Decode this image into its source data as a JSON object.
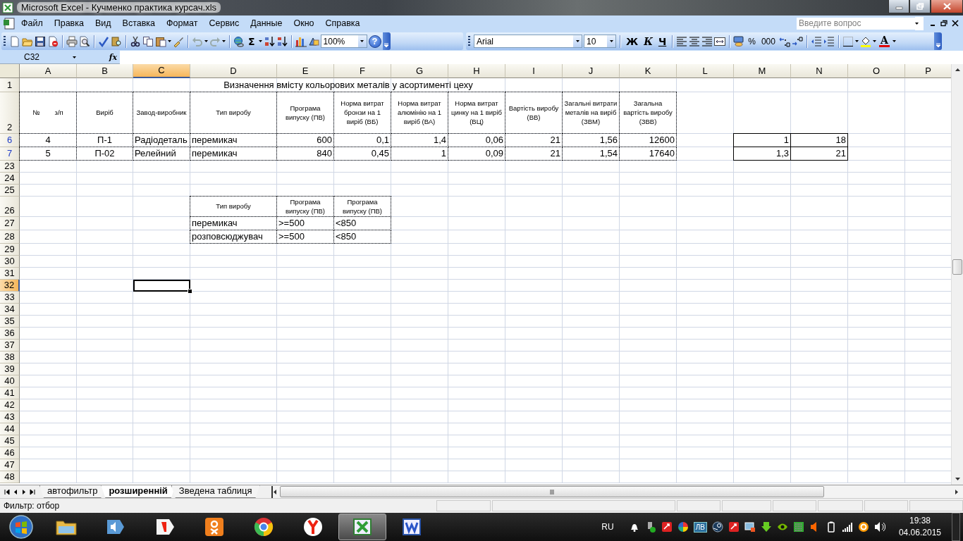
{
  "window": {
    "title": "Microsoft Excel - Кучменко практика курсач.xls"
  },
  "menu": [
    "Файл",
    "Правка",
    "Вид",
    "Вставка",
    "Формат",
    "Сервис",
    "Данные",
    "Окно",
    "Справка"
  ],
  "question_box": {
    "placeholder": "Введите вопрос"
  },
  "standard_toolbar": {
    "autosum": "Σ",
    "zoom": "100%",
    "help": "?"
  },
  "formatting_toolbar": {
    "font": "Arial",
    "size": "10",
    "bold": "Ж",
    "italic": "К",
    "underline": "Ч",
    "percent": "%",
    "thousands": "000",
    "font_color": "A"
  },
  "formula_bar": {
    "name_box": "C32",
    "function_label": "fx"
  },
  "columns": [
    {
      "label": "A",
      "selected": false
    },
    {
      "label": "B",
      "selected": false
    },
    {
      "label": "C",
      "selected": true
    },
    {
      "label": "D",
      "selected": false
    },
    {
      "label": "E",
      "selected": false
    },
    {
      "label": "F",
      "selected": false
    },
    {
      "label": "G",
      "selected": false
    },
    {
      "label": "H",
      "selected": false
    },
    {
      "label": "I",
      "selected": false
    },
    {
      "label": "J",
      "selected": false
    },
    {
      "label": "K",
      "selected": false
    },
    {
      "label": "L",
      "selected": false
    },
    {
      "label": "M",
      "selected": false
    },
    {
      "label": "N",
      "selected": false
    },
    {
      "label": "O",
      "selected": false
    },
    {
      "label": "P",
      "selected": false
    }
  ],
  "rows": [
    {
      "label": "1",
      "selected": false,
      "filtered": false,
      "cells": [
        {
          "kind": "title",
          "text": "Визначення вмісту кольорових металів у асортименті цеху"
        }
      ]
    },
    {
      "label": "2",
      "selected": false,
      "filtered": false,
      "cells": [
        {
          "kind": "header",
          "text": "№        з/п"
        },
        {
          "kind": "header",
          "text": "Виріб"
        },
        {
          "kind": "header",
          "text": "Завод-виробник"
        },
        {
          "kind": "header",
          "text": "Тип виробу"
        },
        {
          "kind": "header",
          "text": "Програма випуску (ПВ)"
        },
        {
          "kind": "header",
          "text": "Норма витрат бронзи на 1 виріб (ВБ)"
        },
        {
          "kind": "header",
          "text": "Норма витрат алюмінію на 1 виріб (ВА)"
        },
        {
          "kind": "header",
          "text": "Норма витрат цинку на 1 виріб (ВЦ)"
        },
        {
          "kind": "header",
          "text": "Вартість виробу (ВВ)"
        },
        {
          "kind": "header",
          "text": "Загальні витрати металів на виріб (ЗВМ)"
        },
        {
          "kind": "header",
          "text": "Загальна вартість виробу (ЗВВ)"
        }
      ]
    },
    {
      "label": "6",
      "selected": false,
      "filtered": true,
      "cells": [
        {
          "kind": "center",
          "text": "4"
        },
        {
          "kind": "center",
          "text": "П-1"
        },
        {
          "kind": "text",
          "text": "Радіодеталь"
        },
        {
          "kind": "text",
          "text": "перемикач"
        },
        {
          "kind": "num",
          "text": "600"
        },
        {
          "kind": "num",
          "text": "0,1"
        },
        {
          "kind": "num",
          "text": "1,4"
        },
        {
          "kind": "num",
          "text": "0,06"
        },
        {
          "kind": "num",
          "text": "21"
        },
        {
          "kind": "num",
          "text": "1,56"
        },
        {
          "kind": "num",
          "text": "12600"
        },
        null,
        {
          "kind": "boxed",
          "text": "1"
        },
        {
          "kind": "boxed",
          "text": "18"
        }
      ]
    },
    {
      "label": "7",
      "selected": false,
      "filtered": true,
      "cells": [
        {
          "kind": "center",
          "text": "5"
        },
        {
          "kind": "center",
          "text": "П-02"
        },
        {
          "kind": "text",
          "text": "Релейний"
        },
        {
          "kind": "text",
          "text": "перемикач"
        },
        {
          "kind": "num",
          "text": "840"
        },
        {
          "kind": "num",
          "text": "0,45"
        },
        {
          "kind": "num",
          "text": "1"
        },
        {
          "kind": "num",
          "text": "0,09"
        },
        {
          "kind": "num",
          "text": "21"
        },
        {
          "kind": "num",
          "text": "1,54"
        },
        {
          "kind": "num",
          "text": "17640"
        },
        null,
        {
          "kind": "boxed",
          "text": "1,3"
        },
        {
          "kind": "boxed",
          "text": "21"
        }
      ]
    },
    {
      "label": "23",
      "selected": false,
      "filtered": false
    },
    {
      "label": "24",
      "selected": false,
      "filtered": false
    },
    {
      "label": "25",
      "selected": false,
      "filtered": false
    },
    {
      "label": "26",
      "selected": false,
      "filtered": false,
      "cells": [
        null,
        null,
        null,
        {
          "kind": "header",
          "text": "Тип виробу"
        },
        {
          "kind": "header",
          "text": "Програма випуску (ПВ)"
        },
        {
          "kind": "header",
          "text": "Програма випуску (ПВ)"
        }
      ]
    },
    {
      "label": "27",
      "selected": false,
      "filtered": false,
      "cells": [
        null,
        null,
        null,
        {
          "kind": "text",
          "text": "перемикач"
        },
        {
          "kind": "text",
          "text": ">=500"
        },
        {
          "kind": "text",
          "text": "<850"
        }
      ]
    },
    {
      "label": "28",
      "selected": false,
      "filtered": false,
      "cells": [
        null,
        null,
        null,
        {
          "kind": "text",
          "text": "розповсюджувач"
        },
        {
          "kind": "text",
          "text": ">=500"
        },
        {
          "kind": "text",
          "text": "<850"
        }
      ]
    },
    {
      "label": "29",
      "selected": false,
      "filtered": false
    },
    {
      "label": "30",
      "selected": false,
      "filtered": false
    },
    {
      "label": "31",
      "selected": false,
      "filtered": false
    },
    {
      "label": "32",
      "selected": true,
      "filtered": false
    },
    {
      "label": "33",
      "selected": false,
      "filtered": false
    },
    {
      "label": "34",
      "selected": false,
      "filtered": false
    },
    {
      "label": "35",
      "selected": false,
      "filtered": false
    },
    {
      "label": "36",
      "selected": false,
      "filtered": false
    },
    {
      "label": "37",
      "selected": false,
      "filtered": false
    },
    {
      "label": "38",
      "selected": false,
      "filtered": false
    },
    {
      "label": "39",
      "selected": false,
      "filtered": false
    },
    {
      "label": "40",
      "selected": false,
      "filtered": false
    },
    {
      "label": "41",
      "selected": false,
      "filtered": false
    },
    {
      "label": "42",
      "selected": false,
      "filtered": false
    },
    {
      "label": "43",
      "selected": false,
      "filtered": false
    },
    {
      "label": "44",
      "selected": false,
      "filtered": false
    },
    {
      "label": "45",
      "selected": false,
      "filtered": false
    },
    {
      "label": "46",
      "selected": false,
      "filtered": false
    },
    {
      "label": "47",
      "selected": false,
      "filtered": false
    },
    {
      "label": "48",
      "selected": false,
      "filtered": false
    }
  ],
  "sheet_tabs": [
    {
      "label": "автофильтр",
      "selected": false
    },
    {
      "label": "розширенній",
      "selected": true
    },
    {
      "label": "Зведена таблиця",
      "selected": false
    }
  ],
  "status_bar": {
    "text": "Фильтр: отбор"
  },
  "taskbar": {
    "language": "RU",
    "time": "19:38",
    "date": "04.06.2015",
    "tray_badge": "ЛВ",
    "apps": [
      {
        "kind": "folder",
        "selected": false
      },
      {
        "kind": "speaker",
        "selected": false
      },
      {
        "kind": "red-tag",
        "selected": false
      },
      {
        "kind": "orange-square",
        "selected": false
      },
      {
        "kind": "chrome",
        "selected": false
      },
      {
        "kind": "yandex",
        "selected": false
      },
      {
        "kind": "excel",
        "selected": true
      },
      {
        "kind": "word",
        "selected": false
      }
    ]
  }
}
